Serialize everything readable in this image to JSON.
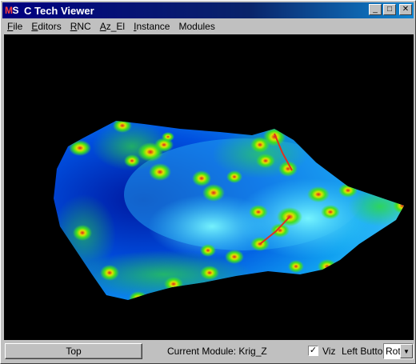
{
  "window": {
    "logo_m": "M",
    "logo_s": "S",
    "title": "C Tech Viewer",
    "controls": {
      "minimize": "_",
      "maximize": "□",
      "close": "✕"
    }
  },
  "menu": [
    {
      "label": "File",
      "accel": "F",
      "rest": "ile"
    },
    {
      "label": "Editors",
      "accel": "E",
      "rest": "ditors"
    },
    {
      "label": "RNC",
      "accel": "R",
      "rest": "NC"
    },
    {
      "label": "Az_El",
      "accel": "A",
      "rest": "z_El"
    },
    {
      "label": "Instance",
      "accel": "I",
      "rest": "nstance"
    },
    {
      "label": "Modules",
      "accel": "",
      "rest": "Modules"
    }
  ],
  "status": {
    "top_button": "Top",
    "current_module": "Current Module: Krig_Z",
    "viz_checked": "✓",
    "viz_label": "Viz",
    "left_button_label": "Left Button",
    "mode_value": "Rot",
    "mode_arrow": "▼"
  },
  "colors": {
    "surface_low": "#0030c0",
    "surface_mid": "#40e0ff",
    "surface_high": "#00e000",
    "peak": "#e02020"
  }
}
